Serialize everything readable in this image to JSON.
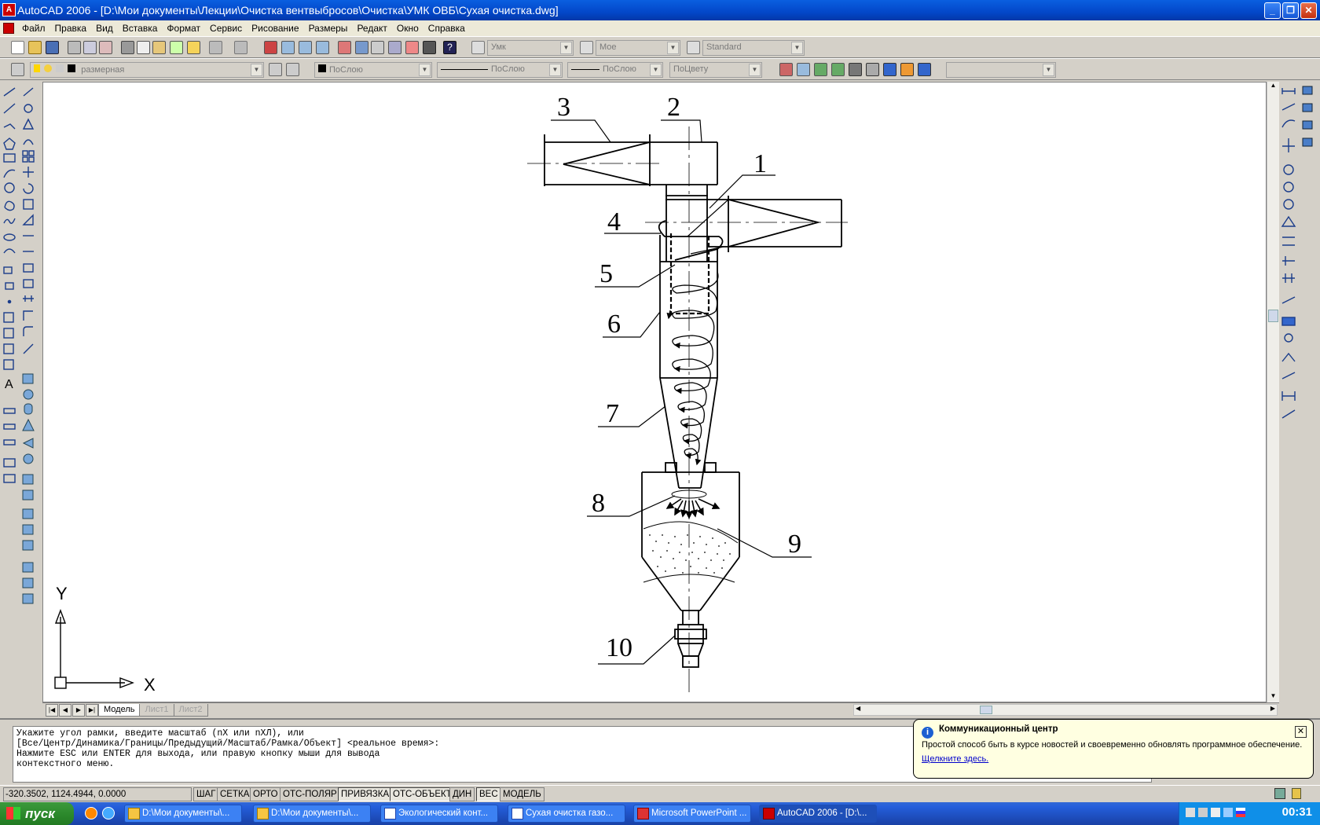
{
  "window": {
    "title": "AutoCAD 2006 - [D:\\Мои документы\\Лекции\\Очистка вентвыбросов\\Очистка\\УМК ОВБ\\Сухая очистка.dwg]",
    "minimize": "_",
    "restore": "❐",
    "close": "✕"
  },
  "menu": {
    "items": [
      "Файл",
      "Правка",
      "Вид",
      "Вставка",
      "Формат",
      "Сервис",
      "Рисование",
      "Размеры",
      "Редакт",
      "Окно",
      "Справка"
    ],
    "mdi_minimize": "–",
    "mdi_restore": "❐",
    "mdi_close": "✕"
  },
  "toolbar_standard": {
    "text_style": "Умк",
    "dim_style": "Мое",
    "table_style": "Standard"
  },
  "toolbar_layers": {
    "layer": "размерная",
    "color": "ПоСлою",
    "linetype": "ПоСлою",
    "lineweight": "ПоСлою",
    "plotstyle": "ПоЦвету"
  },
  "drawing": {
    "labels": [
      "1",
      "2",
      "3",
      "4",
      "5",
      "6",
      "7",
      "8",
      "9",
      "10"
    ],
    "ucs_x": "X",
    "ucs_y": "Y"
  },
  "layout_tabs": {
    "tabs": [
      "Модель",
      "Лист1",
      "Лист2"
    ],
    "active": "Модель"
  },
  "command_line": {
    "lines": [
      "Укажите угол рамки, введите масштаб (nX или nXЛ), или",
      "[Все/Центр/Динамика/Границы/Предыдущий/Масштаб/Рамка/Объект] <реальное время>:",
      "Нажмите ESC или ENTER для выхода, или правую кнопку мыши для вывода",
      "контекстного меню."
    ]
  },
  "balloon": {
    "title": "Коммуникационный центр",
    "body": "Простой способ быть в курсе новостей и своевременно обновлять программное обеспечение.",
    "link": "Щелкните здесь.",
    "info_icon": "i",
    "close": "✕"
  },
  "status": {
    "coords": "-320.3502, 1124.4944, 0.0000",
    "buttons": [
      "ШАГ",
      "СЕТКА",
      "ОРТО",
      "ОТС-ПОЛЯР",
      "ПРИВЯЗКА",
      "ОТС-ОБЪЕКТ",
      "ДИН",
      "ВЕС",
      "МОДЕЛЬ"
    ],
    "on": [
      "ПРИВЯЗКА",
      "ОТС-ОБЪЕКТ",
      "ВЕС"
    ]
  },
  "taskbar": {
    "start": "пуск",
    "tasks": [
      "D:\\Мои документы\\...",
      "D:\\Мои документы\\...",
      "Экологический конт...",
      "Сухая очистка газо...",
      "Microsoft PowerPoint ...",
      "AutoCAD 2006 - [D:\\..."
    ],
    "active_task": 5,
    "clock": "00:31"
  }
}
